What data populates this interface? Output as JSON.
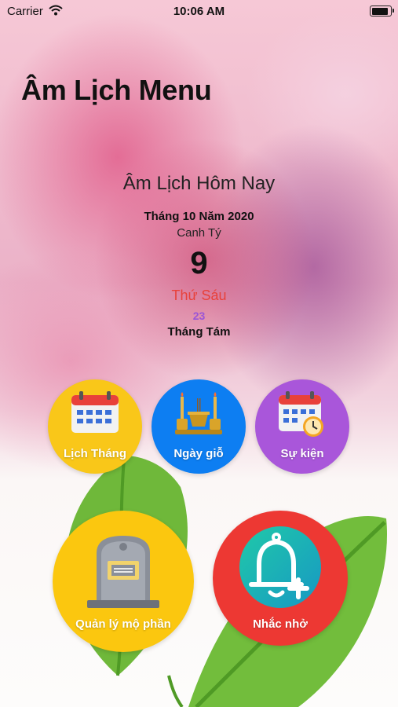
{
  "status_bar": {
    "carrier": "Carrier",
    "time": "10:06 AM"
  },
  "header": {
    "title": "Âm Lịch Menu"
  },
  "today": {
    "title": "Âm Lịch Hôm Nay",
    "month_year": "Tháng 10 Năm 2020",
    "year_name": "Canh Tý",
    "day": "9",
    "weekday": "Thứ Sáu",
    "lunar_day": "23",
    "lunar_month": "Tháng Tám"
  },
  "menu": {
    "items": [
      {
        "label": "Lịch Tháng",
        "icon": "calendar-icon",
        "color": "#f9c719"
      },
      {
        "label": "Ngày giỗ",
        "icon": "incense-altar-icon",
        "color": "#0d7ef2"
      },
      {
        "label": "Sự kiện",
        "icon": "calendar-clock-icon",
        "color": "#a956da"
      },
      {
        "label": "Quản lý mộ phần",
        "icon": "tombstone-icon",
        "color": "#fbc70f"
      },
      {
        "label": "Nhắc nhở",
        "icon": "bell-plus-icon",
        "color": "#ed3833"
      }
    ]
  },
  "colors": {
    "weekday": "#e8413a",
    "lunar_day": "#9b55d6",
    "leaf": "#6fb83a"
  }
}
